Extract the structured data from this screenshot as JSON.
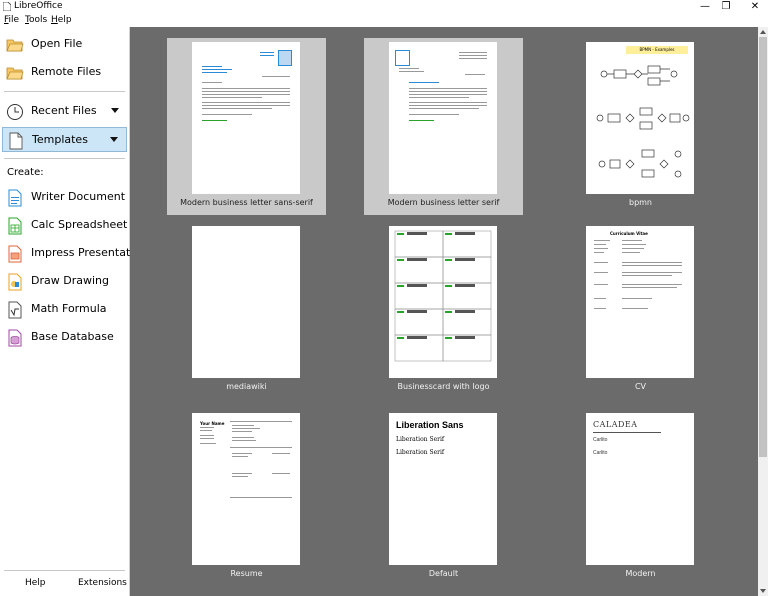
{
  "window": {
    "title": "LibreOffice",
    "minimize": "—",
    "restore": "❐",
    "close": "✕"
  },
  "menu": [
    {
      "label": "File",
      "u": "F",
      "rest": "ile"
    },
    {
      "label": "Tools",
      "u": "T",
      "rest": "ools"
    },
    {
      "label": "Help",
      "u": "H",
      "rest": "elp"
    }
  ],
  "sidebar": {
    "open_file": "Open File",
    "remote_files": "Remote Files",
    "recent_files": "Recent Files",
    "templates": "Templates",
    "create_label": "Create:",
    "create": [
      {
        "label": "Writer Document",
        "icon": "writer-icon",
        "color": "#2a8bd6"
      },
      {
        "label": "Calc Spreadsheet",
        "icon": "calc-icon",
        "color": "#29a329"
      },
      {
        "label": "Impress Presentation",
        "icon": "impress-icon",
        "color": "#e0643a"
      },
      {
        "label": "Draw Drawing",
        "icon": "draw-icon",
        "color": "#e6a020"
      },
      {
        "label": "Math Formula",
        "icon": "math-icon",
        "color": "#555555"
      },
      {
        "label": "Base Database",
        "icon": "base-icon",
        "color": "#a04aa0"
      }
    ],
    "help": "Help",
    "extensions": "Extensions"
  },
  "templates": [
    {
      "label": "Modern business letter sans-serif",
      "highlighted": true
    },
    {
      "label": "Modern business letter serif",
      "highlighted": true
    },
    {
      "label": "bpmn",
      "highlighted": false,
      "thumb_title": "BPMN - Examples"
    },
    {
      "label": "mediawiki",
      "highlighted": false
    },
    {
      "label": "Businesscard with logo",
      "highlighted": false
    },
    {
      "label": "CV",
      "highlighted": false,
      "thumb_title": "Curriculum Vitae"
    },
    {
      "label": "Resume",
      "highlighted": false,
      "thumb_title": "Your Name"
    },
    {
      "label": "Default",
      "highlighted": false,
      "thumb_heading": "Liberation Sans",
      "thumb_lines": [
        "Liberation Serif",
        "Liberation Serif"
      ]
    },
    {
      "label": "Modern",
      "highlighted": false,
      "thumb_heading": "CALADEA",
      "thumb_lines": [
        "Carlito",
        "Carlito"
      ]
    }
  ],
  "colors": {
    "main_bg": "#6b6b6b",
    "selected_bg": "#cde6f7",
    "tile_highlight": "#c9c9c9"
  }
}
